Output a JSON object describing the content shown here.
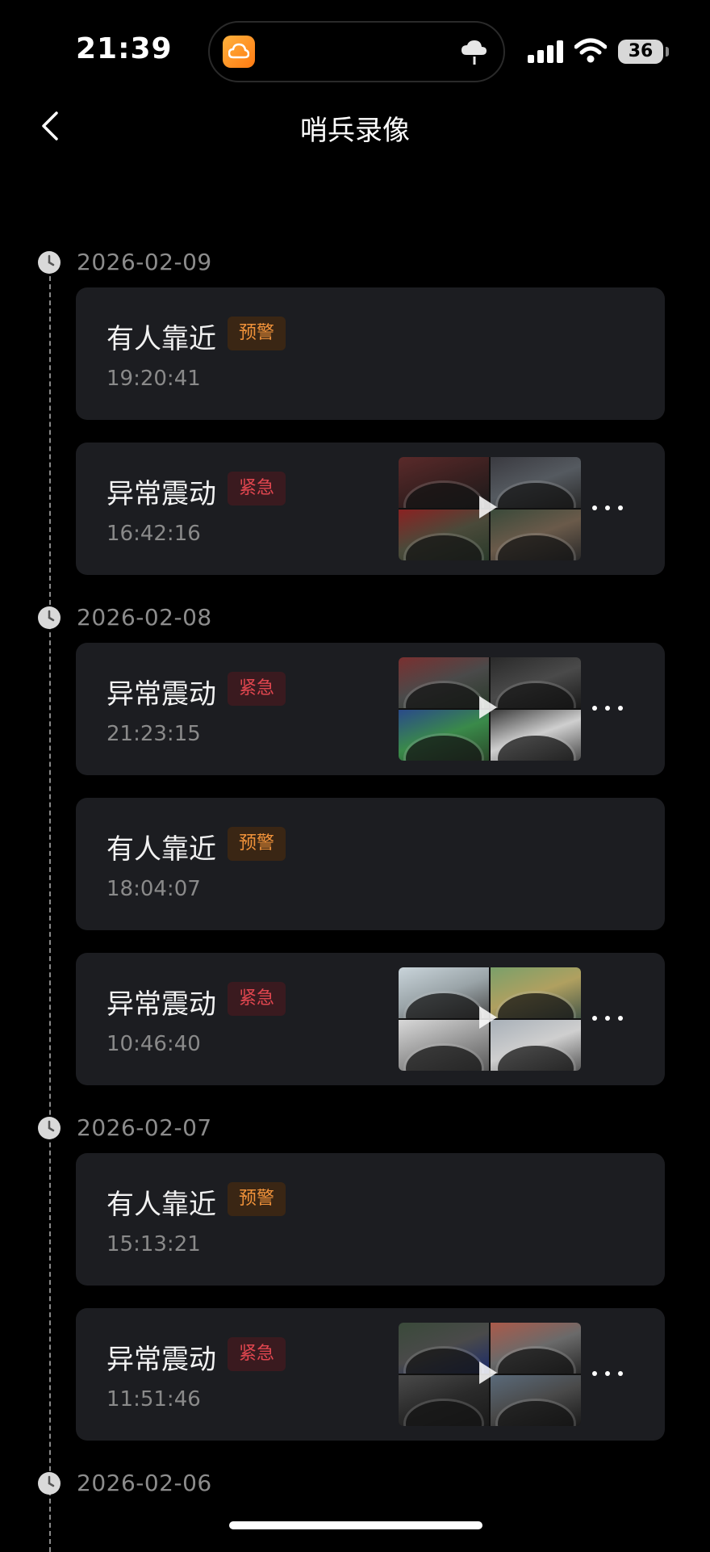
{
  "status_bar": {
    "time": "21:39",
    "battery": "36",
    "icons": [
      "app-cloud-icon",
      "weather-icon",
      "signal-icon",
      "wifi-icon",
      "battery-icon"
    ]
  },
  "nav": {
    "title": "哨兵录像",
    "back_icon": "chevron-left-icon"
  },
  "colors": {
    "background": "#000000",
    "card": "#1c1d21",
    "warn_text": "#f0923a",
    "urgent_text": "#e0464f",
    "date_text": "#8c8c8c"
  },
  "groups": [
    {
      "date": "2026-02-09",
      "events": [
        {
          "title": "有人靠近",
          "badge": "预警",
          "level": "warn",
          "time": "19:20:41",
          "has_video": false
        },
        {
          "title": "异常震动",
          "badge": "紧急",
          "level": "urgent",
          "time": "16:42:16",
          "has_video": true,
          "scene": "scene-night-a"
        }
      ]
    },
    {
      "date": "2026-02-08",
      "events": [
        {
          "title": "异常震动",
          "badge": "紧急",
          "level": "urgent",
          "time": "21:23:15",
          "has_video": true,
          "scene": "scene-night-b"
        },
        {
          "title": "有人靠近",
          "badge": "预警",
          "level": "warn",
          "time": "18:04:07",
          "has_video": false
        },
        {
          "title": "异常震动",
          "badge": "紧急",
          "level": "urgent",
          "time": "10:46:40",
          "has_video": true,
          "scene": "scene-day"
        }
      ]
    },
    {
      "date": "2026-02-07",
      "events": [
        {
          "title": "有人靠近",
          "badge": "预警",
          "level": "warn",
          "time": "15:13:21",
          "has_video": false
        },
        {
          "title": "异常震动",
          "badge": "紧急",
          "level": "urgent",
          "time": "11:51:46",
          "has_video": true,
          "scene": "scene-night-c"
        }
      ]
    },
    {
      "date": "2026-02-06",
      "events": []
    }
  ]
}
